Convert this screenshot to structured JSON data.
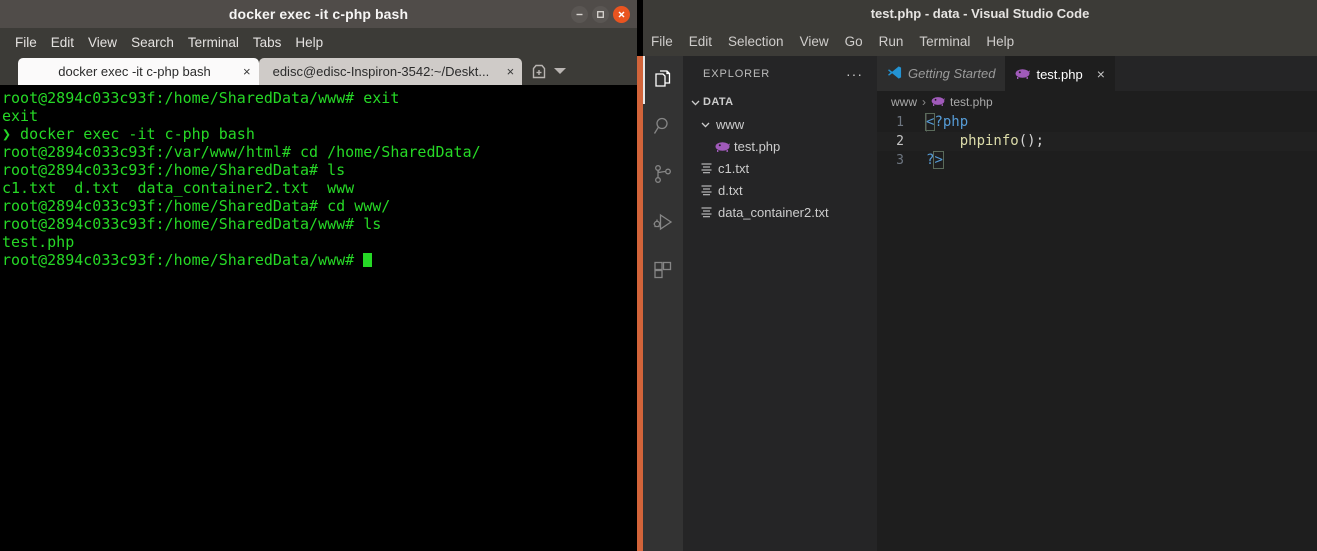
{
  "terminal": {
    "window_title": "docker exec -it c-php bash",
    "window_buttons": [
      "minimize",
      "maximize",
      "close"
    ],
    "menu": [
      "File",
      "Edit",
      "View",
      "Search",
      "Terminal",
      "Tabs",
      "Help"
    ],
    "tabs": [
      {
        "label": "docker exec -it c-php bash",
        "active": true,
        "close": "×"
      },
      {
        "label": "edisc@edisc-Inspiron-3542:~/Deskt...",
        "active": false,
        "close": "×"
      }
    ],
    "new_tab_icon": "new-tab-icon",
    "lines": [
      "root@2894c033c93f:/home/SharedData/www# exit",
      "exit",
      "❯ docker exec -it c-php bash",
      "root@2894c033c93f:/var/www/html# cd /home/SharedData/",
      "root@2894c033c93f:/home/SharedData# ls",
      "c1.txt  d.txt  data_container2.txt  www",
      "root@2894c033c93f:/home/SharedData# cd www/",
      "root@2894c033c93f:/home/SharedData/www# ls",
      "test.php",
      "root@2894c033c93f:/home/SharedData/www# "
    ],
    "prompt_chevron": "❯",
    "text_color": "#26d826",
    "background": "#000000"
  },
  "vscode": {
    "window_title": "test.php - data - Visual Studio Code",
    "menu": [
      "File",
      "Edit",
      "Selection",
      "View",
      "Go",
      "Run",
      "Terminal",
      "Help"
    ],
    "activity_bar": [
      {
        "name": "explorer",
        "icon": "files-icon",
        "active": true
      },
      {
        "name": "search",
        "icon": "search-icon",
        "active": false
      },
      {
        "name": "source-control",
        "icon": "source-control-icon",
        "active": false
      },
      {
        "name": "run-debug",
        "icon": "run-and-debug-icon",
        "active": false
      },
      {
        "name": "extensions",
        "icon": "extensions-icon",
        "active": false
      }
    ],
    "explorer": {
      "title": "EXPLORER",
      "more_actions": "···",
      "root_folder": "DATA",
      "tree": [
        {
          "label": "www",
          "type": "folder",
          "depth": 1,
          "expanded": true,
          "icon": "folder-icon"
        },
        {
          "label": "test.php",
          "type": "file",
          "depth": 2,
          "icon": "php-file-icon"
        },
        {
          "label": "c1.txt",
          "type": "file",
          "depth": 1,
          "icon": "text-file-icon"
        },
        {
          "label": "d.txt",
          "type": "file",
          "depth": 1,
          "icon": "text-file-icon"
        },
        {
          "label": "data_container2.txt",
          "type": "file",
          "depth": 1,
          "icon": "text-file-icon"
        }
      ]
    },
    "editor": {
      "tabs": [
        {
          "label": "Getting Started",
          "icon": "vscode-logo-icon",
          "active": false,
          "dirty": false
        },
        {
          "label": "test.php",
          "icon": "php-file-icon",
          "active": true,
          "close": "×"
        }
      ],
      "breadcrumb": [
        "www",
        "test.php"
      ],
      "breadcrumb_separator": "›",
      "active_line": 2,
      "lines": [
        {
          "number": "1",
          "tokens": [
            {
              "t": "<",
              "c": "tok-blue bracket-box"
            },
            {
              "t": "?php",
              "c": "tok-blue"
            }
          ]
        },
        {
          "number": "2",
          "tokens": [
            {
              "t": "    ",
              "c": "tok-punct"
            },
            {
              "t": "phpinfo",
              "c": "tok-fn"
            },
            {
              "t": "();",
              "c": "tok-punct"
            }
          ]
        },
        {
          "number": "3",
          "tokens": [
            {
              "t": "?",
              "c": "tok-blue"
            },
            {
              "t": ">",
              "c": "tok-blue bracket-box"
            }
          ]
        }
      ]
    }
  },
  "colors": {
    "ubuntu_orange": "#e95420",
    "terminal_green": "#26d826",
    "vscode_bg": "#1e1e1e",
    "sidebar_bg": "#252526",
    "activity_bar_bg": "#333333",
    "titlebar_bg": "#3c3b37"
  }
}
